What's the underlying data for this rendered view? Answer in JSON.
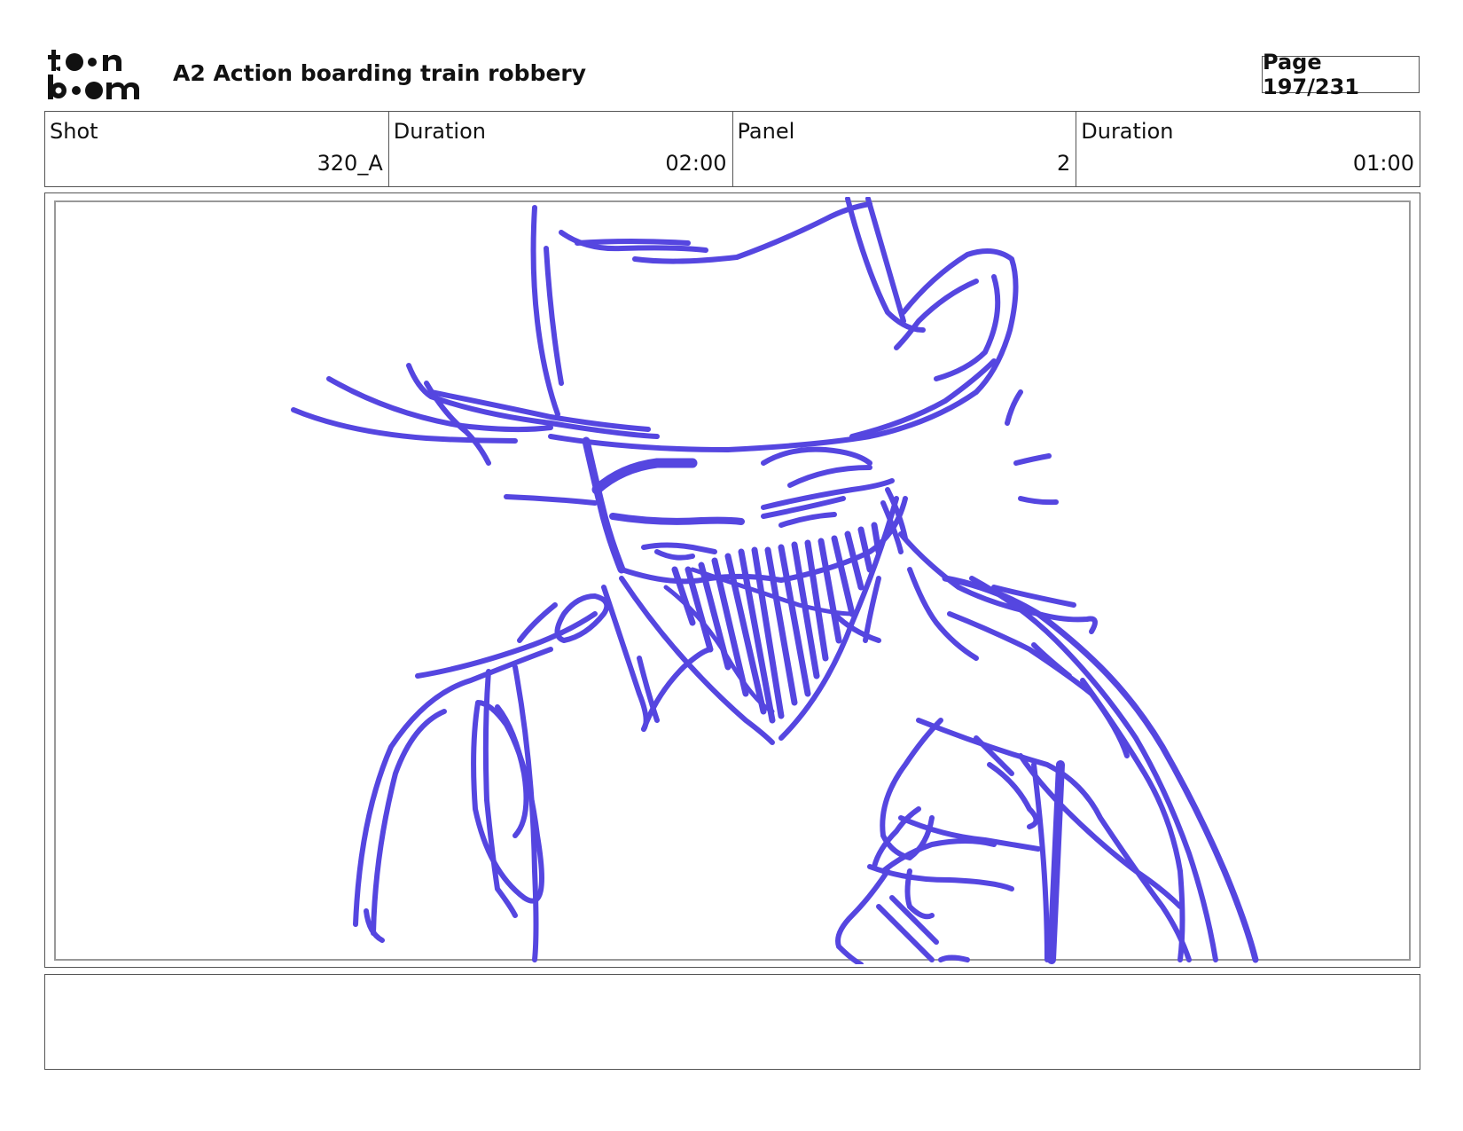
{
  "header": {
    "title": "A2 Action boarding train robbery",
    "page": "Page 197/231"
  },
  "logo": {
    "icon": "toon-boom-logo",
    "text": "toon boom"
  },
  "shot_info": [
    {
      "label": "Shot",
      "value": "320_A"
    },
    {
      "label": "Duration",
      "value": "02:00"
    },
    {
      "label": "Panel",
      "value": "2"
    },
    {
      "label": "Duration",
      "value": "01:00"
    }
  ],
  "panel": {
    "sketch_color": "#5546e0",
    "subject": "sketch-drawing"
  },
  "notes": {
    "text": ""
  }
}
